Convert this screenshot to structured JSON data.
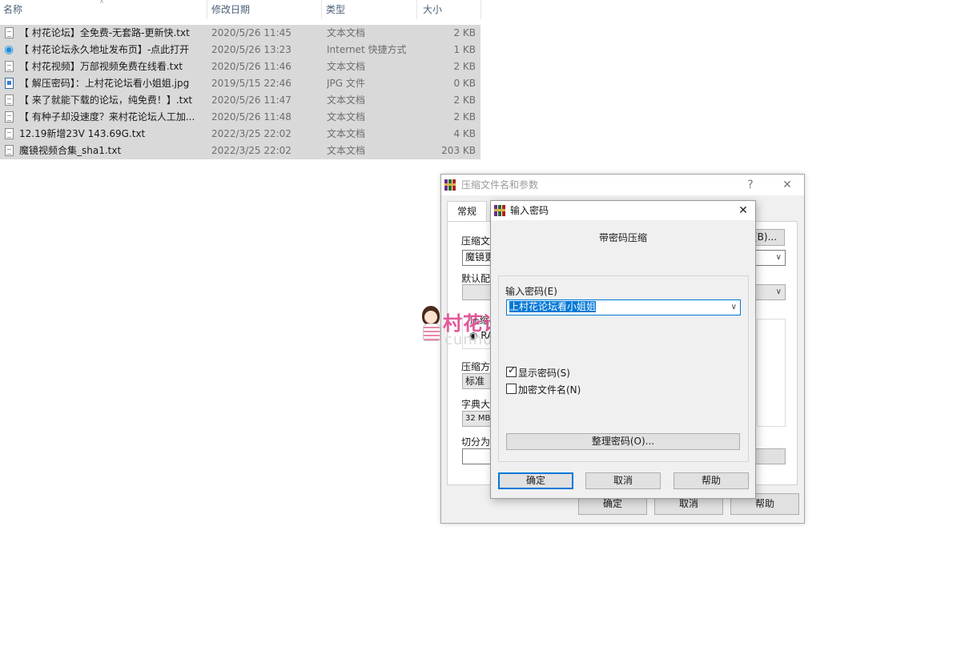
{
  "explorer": {
    "columns": {
      "name": "名称",
      "date": "修改日期",
      "type": "类型",
      "size": "大小"
    },
    "files": [
      {
        "name": "【 村花论坛】全免费-无套路-更新快.txt",
        "date": "2020/5/26 11:45",
        "type": "文本文档",
        "size": "2 KB",
        "icon": "text-file-icon"
      },
      {
        "name": "【 村花论坛永久地址发布页】-点此打开",
        "date": "2020/5/26 13:23",
        "type": "Internet 快捷方式",
        "size": "1 KB",
        "icon": "internet-shortcut-icon"
      },
      {
        "name": "【 村花视频】万部视频免费在线看.txt",
        "date": "2020/5/26 11:46",
        "type": "文本文档",
        "size": "2 KB",
        "icon": "text-file-icon"
      },
      {
        "name": "【 解压密码】：上村花论坛看小姐姐.jpg",
        "date": "2019/5/15 22:46",
        "type": "JPG 文件",
        "size": "0 KB",
        "icon": "image-file-icon"
      },
      {
        "name": "【 来了就能下载的论坛，纯免费！】.txt",
        "date": "2020/5/26 11:47",
        "type": "文本文档",
        "size": "2 KB",
        "icon": "text-file-icon"
      },
      {
        "name": "【 有种子却没速度？来村花论坛人工加...",
        "date": "2020/5/26 11:48",
        "type": "文本文档",
        "size": "2 KB",
        "icon": "text-file-icon"
      },
      {
        "name": "12.19新增23V 143.69G.txt",
        "date": "2022/3/25 22:02",
        "type": "文本文档",
        "size": "4 KB",
        "icon": "text-file-icon"
      },
      {
        "name": "魔镜视频合集_sha1.txt",
        "date": "2022/3/25 22:02",
        "type": "文本文档",
        "size": "203 KB",
        "icon": "text-file-icon"
      }
    ]
  },
  "archive_dialog": {
    "title": "压缩文件名和参数",
    "help_glyph": "?",
    "close_glyph": "✕",
    "tab_general": "常规",
    "archive_name_label": "压缩文",
    "archive_name_value": "魔镜更",
    "browse_label": "(B)...",
    "default_profile_label": "默认配",
    "format_label": "压缩",
    "format_rar": "RA",
    "method_label": "压缩方",
    "method_value": "标准",
    "dict_label": "字典大",
    "dict_value": "32 MB",
    "split_label": "切分为",
    "ok": "确定",
    "cancel": "取消",
    "help": "帮助"
  },
  "password_dialog": {
    "title": "输入密码",
    "close_glyph": "✕",
    "header": "带密码压缩",
    "password_label": "输入密码(E)",
    "password_value": "上村花论坛看小姐姐",
    "show_password_label": "显示密码(S)",
    "show_password_checked": true,
    "encrypt_names_label": "加密文件名(N)",
    "encrypt_names_checked": false,
    "organize_label": "整理密码(O)...",
    "ok": "确定",
    "cancel": "取消",
    "help": "帮助"
  },
  "watermark": {
    "text": "村花论坛",
    "url": "cunhua.win"
  },
  "colors": {
    "row_selected": "#d9d9d9",
    "accent_blue": "#0078d7",
    "watermark_pink": "#e4579a"
  }
}
